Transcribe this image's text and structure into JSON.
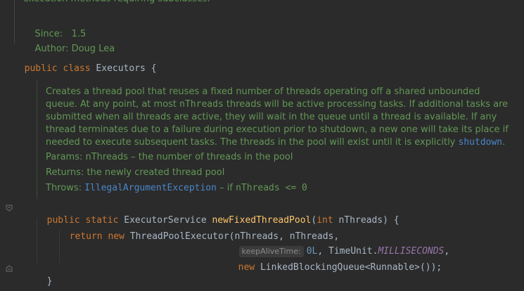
{
  "top_doc": {
    "truncated_line": "execution methods requiring subclasses.",
    "since_label": "Since:",
    "since_value": "1.5",
    "author_label": "Author:",
    "author_value": "Doug Lea"
  },
  "class_decl": {
    "kw1": "public",
    "kw2": "class",
    "name": "Executors",
    "brace": "{"
  },
  "method_doc": {
    "line1": "Creates a thread pool that reuses a fixed number of threads operating off a shared unbounded",
    "line2_pre": "queue. At any point, at most ",
    "line2_code": "nThreads",
    "line2_post": " threads will be active processing tasks. If additional tasks are",
    "line3": "submitted when all threads are active, they will wait in the queue until a thread is available. If any",
    "line4": "thread terminates due to a failure during execution prior to shutdown, a new one will take its place if",
    "line5_pre": "needed to execute subsequent tasks. The threads in the pool will exist until it is explicitly ",
    "line5_link": "shutdown",
    "line5_post": ".",
    "params_label": "Params:",
    "params_value": "nThreads – the number of threads in the pool",
    "returns_label": "Returns:",
    "returns_value": "the newly created thread pool",
    "throws_label": "Throws:",
    "throws_link": "IllegalArgumentException",
    "throws_mid": " – if ",
    "throws_code": "nThreads <= 0"
  },
  "method": {
    "kw_public": "public",
    "kw_static": "static",
    "return_type": "ExecutorService",
    "name": "newFixedThreadPool",
    "open_paren": "(",
    "param_type": "int",
    "param_name": " nThreads",
    "close": ") {",
    "kw_return": "return",
    "kw_new": "new",
    "ctor": "ThreadPoolExecutor(nThreads, nThreads,",
    "hint_label": "keepAliveTime:",
    "arg_num": "0L",
    "arg_sep": ", TimeUnit.",
    "arg_const": "MILLISECONDS",
    "arg_comma": ",",
    "kw_new2": "new",
    "queue_ctor": "LinkedBlockingQueue<Runnable>());",
    "end_brace": "}"
  },
  "colors": {
    "background": "#2b2b2b",
    "doc_green": "#629755",
    "keyword": "#cc7832",
    "method": "#ffc66d",
    "link": "#4a86c8"
  }
}
